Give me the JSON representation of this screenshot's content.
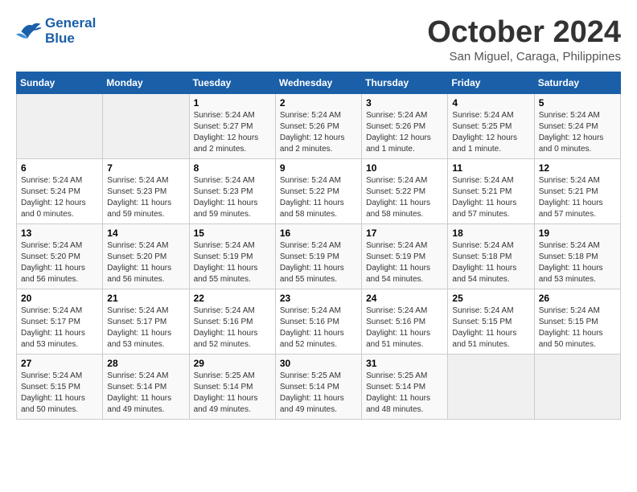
{
  "header": {
    "logo_line1": "General",
    "logo_line2": "Blue",
    "month": "October 2024",
    "location": "San Miguel, Caraga, Philippines"
  },
  "weekdays": [
    "Sunday",
    "Monday",
    "Tuesday",
    "Wednesday",
    "Thursday",
    "Friday",
    "Saturday"
  ],
  "weeks": [
    [
      {
        "day": "",
        "sunrise": "",
        "sunset": "",
        "daylight": ""
      },
      {
        "day": "",
        "sunrise": "",
        "sunset": "",
        "daylight": ""
      },
      {
        "day": "1",
        "sunrise": "Sunrise: 5:24 AM",
        "sunset": "Sunset: 5:27 PM",
        "daylight": "Daylight: 12 hours and 2 minutes."
      },
      {
        "day": "2",
        "sunrise": "Sunrise: 5:24 AM",
        "sunset": "Sunset: 5:26 PM",
        "daylight": "Daylight: 12 hours and 2 minutes."
      },
      {
        "day": "3",
        "sunrise": "Sunrise: 5:24 AM",
        "sunset": "Sunset: 5:26 PM",
        "daylight": "Daylight: 12 hours and 1 minute."
      },
      {
        "day": "4",
        "sunrise": "Sunrise: 5:24 AM",
        "sunset": "Sunset: 5:25 PM",
        "daylight": "Daylight: 12 hours and 1 minute."
      },
      {
        "day": "5",
        "sunrise": "Sunrise: 5:24 AM",
        "sunset": "Sunset: 5:24 PM",
        "daylight": "Daylight: 12 hours and 0 minutes."
      }
    ],
    [
      {
        "day": "6",
        "sunrise": "Sunrise: 5:24 AM",
        "sunset": "Sunset: 5:24 PM",
        "daylight": "Daylight: 12 hours and 0 minutes."
      },
      {
        "day": "7",
        "sunrise": "Sunrise: 5:24 AM",
        "sunset": "Sunset: 5:23 PM",
        "daylight": "Daylight: 11 hours and 59 minutes."
      },
      {
        "day": "8",
        "sunrise": "Sunrise: 5:24 AM",
        "sunset": "Sunset: 5:23 PM",
        "daylight": "Daylight: 11 hours and 59 minutes."
      },
      {
        "day": "9",
        "sunrise": "Sunrise: 5:24 AM",
        "sunset": "Sunset: 5:22 PM",
        "daylight": "Daylight: 11 hours and 58 minutes."
      },
      {
        "day": "10",
        "sunrise": "Sunrise: 5:24 AM",
        "sunset": "Sunset: 5:22 PM",
        "daylight": "Daylight: 11 hours and 58 minutes."
      },
      {
        "day": "11",
        "sunrise": "Sunrise: 5:24 AM",
        "sunset": "Sunset: 5:21 PM",
        "daylight": "Daylight: 11 hours and 57 minutes."
      },
      {
        "day": "12",
        "sunrise": "Sunrise: 5:24 AM",
        "sunset": "Sunset: 5:21 PM",
        "daylight": "Daylight: 11 hours and 57 minutes."
      }
    ],
    [
      {
        "day": "13",
        "sunrise": "Sunrise: 5:24 AM",
        "sunset": "Sunset: 5:20 PM",
        "daylight": "Daylight: 11 hours and 56 minutes."
      },
      {
        "day": "14",
        "sunrise": "Sunrise: 5:24 AM",
        "sunset": "Sunset: 5:20 PM",
        "daylight": "Daylight: 11 hours and 56 minutes."
      },
      {
        "day": "15",
        "sunrise": "Sunrise: 5:24 AM",
        "sunset": "Sunset: 5:19 PM",
        "daylight": "Daylight: 11 hours and 55 minutes."
      },
      {
        "day": "16",
        "sunrise": "Sunrise: 5:24 AM",
        "sunset": "Sunset: 5:19 PM",
        "daylight": "Daylight: 11 hours and 55 minutes."
      },
      {
        "day": "17",
        "sunrise": "Sunrise: 5:24 AM",
        "sunset": "Sunset: 5:19 PM",
        "daylight": "Daylight: 11 hours and 54 minutes."
      },
      {
        "day": "18",
        "sunrise": "Sunrise: 5:24 AM",
        "sunset": "Sunset: 5:18 PM",
        "daylight": "Daylight: 11 hours and 54 minutes."
      },
      {
        "day": "19",
        "sunrise": "Sunrise: 5:24 AM",
        "sunset": "Sunset: 5:18 PM",
        "daylight": "Daylight: 11 hours and 53 minutes."
      }
    ],
    [
      {
        "day": "20",
        "sunrise": "Sunrise: 5:24 AM",
        "sunset": "Sunset: 5:17 PM",
        "daylight": "Daylight: 11 hours and 53 minutes."
      },
      {
        "day": "21",
        "sunrise": "Sunrise: 5:24 AM",
        "sunset": "Sunset: 5:17 PM",
        "daylight": "Daylight: 11 hours and 53 minutes."
      },
      {
        "day": "22",
        "sunrise": "Sunrise: 5:24 AM",
        "sunset": "Sunset: 5:16 PM",
        "daylight": "Daylight: 11 hours and 52 minutes."
      },
      {
        "day": "23",
        "sunrise": "Sunrise: 5:24 AM",
        "sunset": "Sunset: 5:16 PM",
        "daylight": "Daylight: 11 hours and 52 minutes."
      },
      {
        "day": "24",
        "sunrise": "Sunrise: 5:24 AM",
        "sunset": "Sunset: 5:16 PM",
        "daylight": "Daylight: 11 hours and 51 minutes."
      },
      {
        "day": "25",
        "sunrise": "Sunrise: 5:24 AM",
        "sunset": "Sunset: 5:15 PM",
        "daylight": "Daylight: 11 hours and 51 minutes."
      },
      {
        "day": "26",
        "sunrise": "Sunrise: 5:24 AM",
        "sunset": "Sunset: 5:15 PM",
        "daylight": "Daylight: 11 hours and 50 minutes."
      }
    ],
    [
      {
        "day": "27",
        "sunrise": "Sunrise: 5:24 AM",
        "sunset": "Sunset: 5:15 PM",
        "daylight": "Daylight: 11 hours and 50 minutes."
      },
      {
        "day": "28",
        "sunrise": "Sunrise: 5:24 AM",
        "sunset": "Sunset: 5:14 PM",
        "daylight": "Daylight: 11 hours and 49 minutes."
      },
      {
        "day": "29",
        "sunrise": "Sunrise: 5:25 AM",
        "sunset": "Sunset: 5:14 PM",
        "daylight": "Daylight: 11 hours and 49 minutes."
      },
      {
        "day": "30",
        "sunrise": "Sunrise: 5:25 AM",
        "sunset": "Sunset: 5:14 PM",
        "daylight": "Daylight: 11 hours and 49 minutes."
      },
      {
        "day": "31",
        "sunrise": "Sunrise: 5:25 AM",
        "sunset": "Sunset: 5:14 PM",
        "daylight": "Daylight: 11 hours and 48 minutes."
      },
      {
        "day": "",
        "sunrise": "",
        "sunset": "",
        "daylight": ""
      },
      {
        "day": "",
        "sunrise": "",
        "sunset": "",
        "daylight": ""
      }
    ]
  ]
}
